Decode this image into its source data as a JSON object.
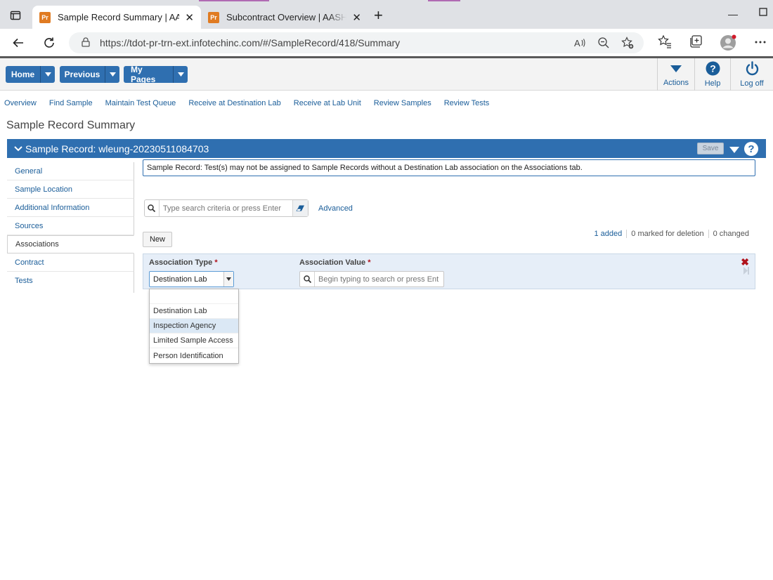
{
  "browser": {
    "tabs": [
      {
        "title": "Sample Record Summary | AASH",
        "favicon_text": "Pr"
      },
      {
        "title": "Subcontract Overview | AASHTO\\",
        "favicon_text": "Pr"
      }
    ],
    "url": "https://tdot-pr-trn-ext.infotechinc.com/#/SampleRecord/418/Summary"
  },
  "header": {
    "buttons": [
      {
        "label": "Home"
      },
      {
        "label": "Previous"
      },
      {
        "label": "My Pages"
      }
    ],
    "tools": [
      {
        "label": "Actions",
        "icon": "chevron-down-icon"
      },
      {
        "label": "Help",
        "icon": "help-circle-icon"
      },
      {
        "label": "Log off",
        "icon": "power-icon"
      }
    ]
  },
  "navlinks": [
    "Overview",
    "Find Sample",
    "Maintain Test Queue",
    "Receive at Destination Lab",
    "Receive at Lab Unit",
    "Review Samples",
    "Review Tests"
  ],
  "page": {
    "title": "Sample Record Summary",
    "record_title": "Sample Record: wleung-20230511084703",
    "save_label": "Save"
  },
  "sidebar": {
    "items": [
      "General",
      "Sample Location",
      "Additional Information",
      "Sources",
      "Associations",
      "Contract",
      "Tests"
    ],
    "active_index": 4
  },
  "alert": {
    "message": "Sample Record: Test(s) may not be assigned to Sample Records without a Destination Lab association on the Associations tab."
  },
  "search": {
    "placeholder": "Type search criteria or press Enter",
    "advanced_label": "Advanced"
  },
  "toolbar": {
    "new_label": "New",
    "counts": {
      "added": "1 added",
      "deleted": "0 marked for deletion",
      "changed": "0 changed"
    }
  },
  "grid": {
    "columns": {
      "type": "Association Type",
      "value": "Association Value",
      "required_mark": "*"
    },
    "row": {
      "type_value": "Destination Lab",
      "value_placeholder": "Begin typing to search or press Ent"
    }
  },
  "dropdown": {
    "options": [
      "",
      "Destination Lab",
      "Inspection Agency",
      "Limited Sample Access",
      "Person Identification"
    ],
    "highlighted_index": 2
  },
  "colors": {
    "primary": "#2f6fb0",
    "link": "#1a5d99",
    "required": "#b0121b",
    "row_bg": "#e6eef8"
  }
}
